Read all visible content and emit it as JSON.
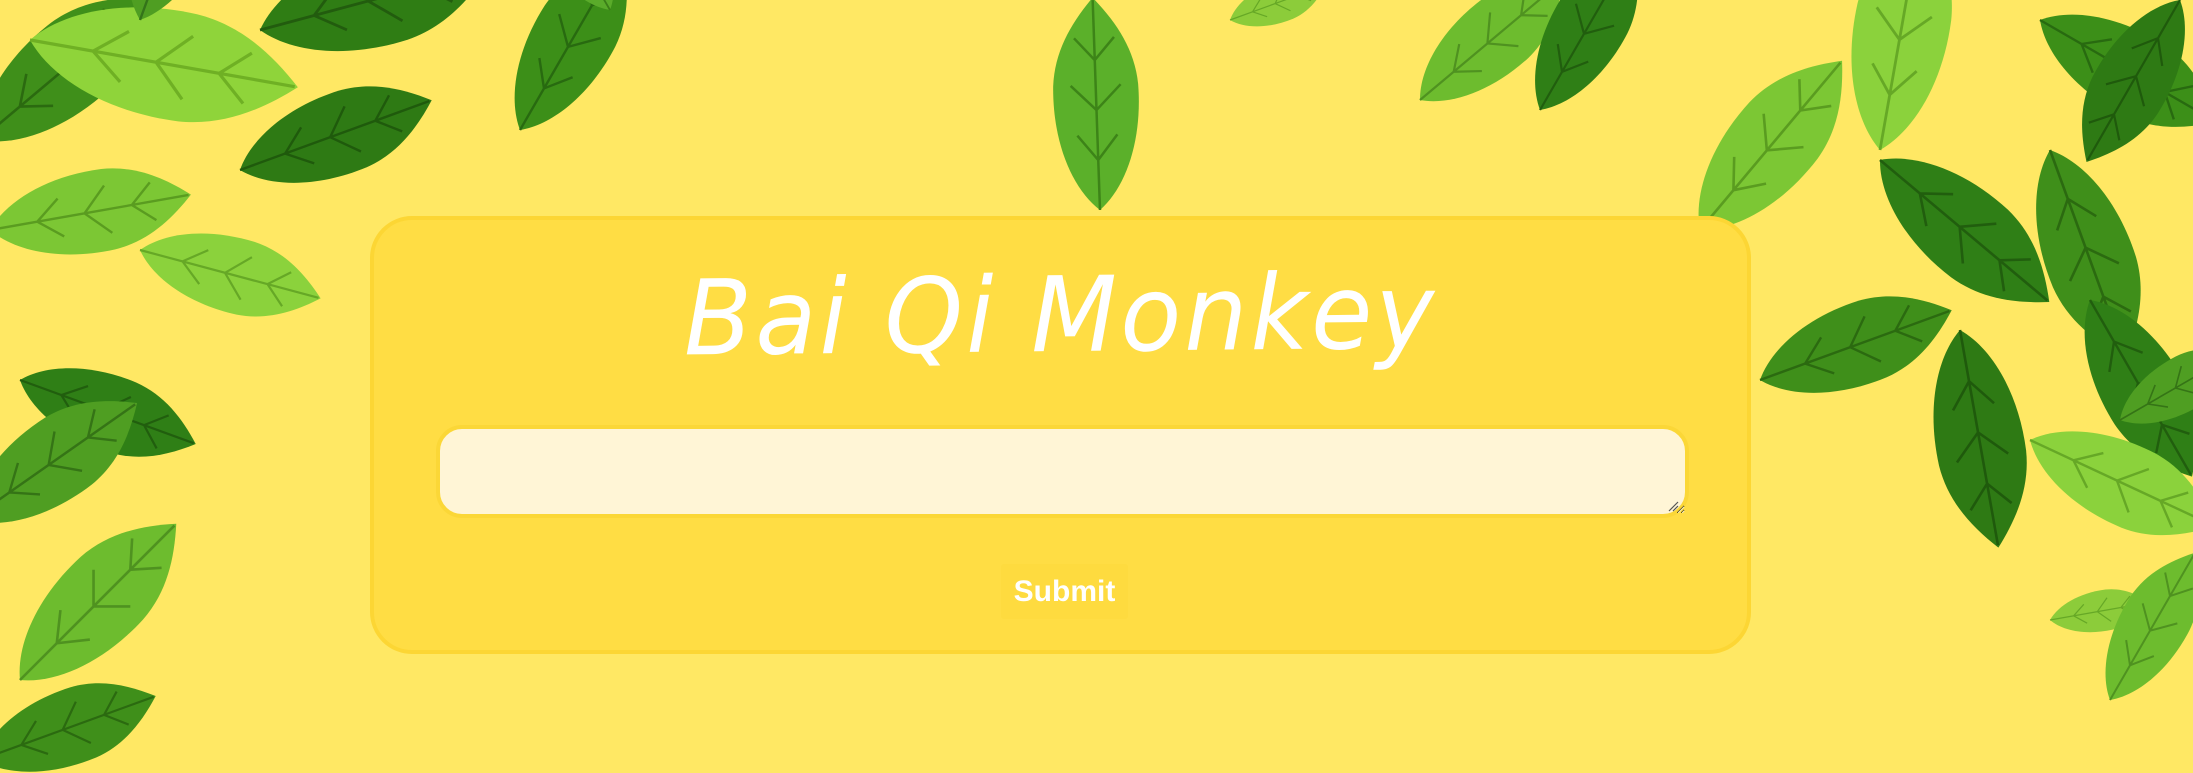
{
  "app": {
    "title": "Bai Qi Monkey"
  },
  "form": {
    "input_value": "",
    "input_placeholder": "",
    "submit_label": "Submit"
  },
  "theme": {
    "background": "#ffe864",
    "card_background": "#ffdd44",
    "card_border": "#fcd634",
    "input_background": "#fff5d6",
    "text_color": "#ffffff"
  }
}
